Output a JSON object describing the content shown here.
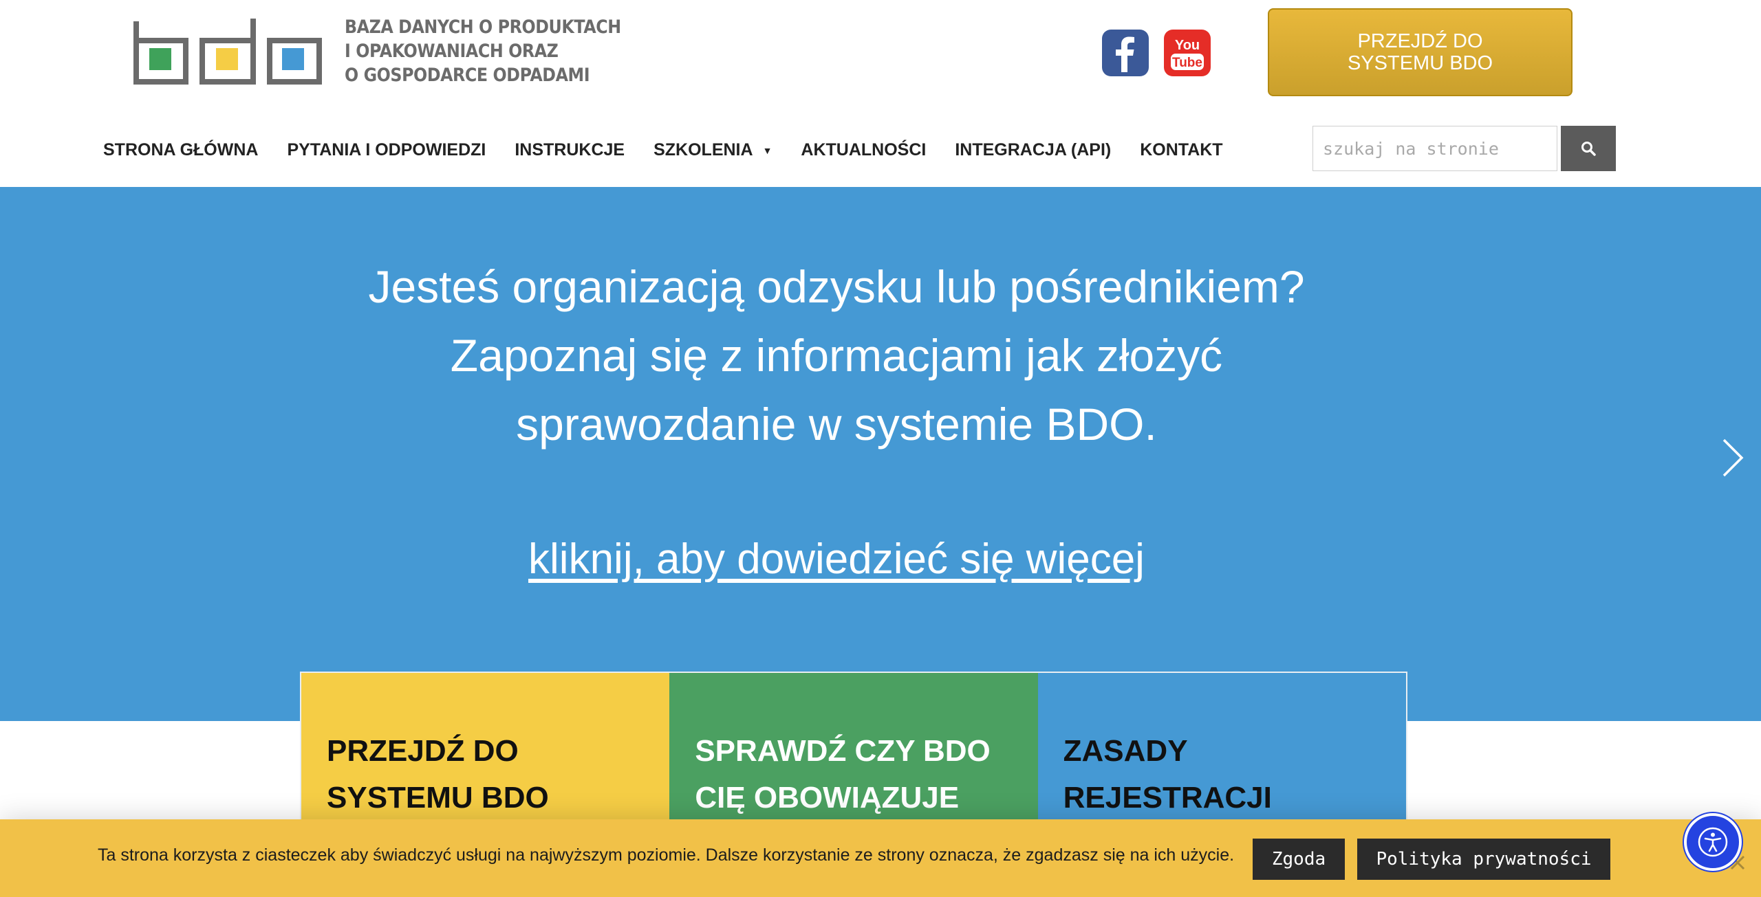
{
  "brand": {
    "logo_icon": "bdo-logo-icon",
    "logo_colors": {
      "green": "#3fa25a",
      "yellow": "#f5cd45",
      "blue": "#4599d4",
      "frame": "#6b6b6b"
    },
    "logo_lines": [
      "BAZA DANYCH O PRODUKTACH",
      "I OPAKOWANIACH ORAZ",
      "O GOSPODARCE ODPADAMI"
    ]
  },
  "social": {
    "facebook": {
      "icon": "facebook-icon",
      "glyph": "f",
      "color": "#3b5998"
    },
    "youtube": {
      "icon": "youtube-icon",
      "line1": "You",
      "line2": "Tube",
      "color": "#e52d27"
    }
  },
  "header_cta": {
    "line1": "PRZEJDŹ DO",
    "line2": "SYSTEMU BDO"
  },
  "nav": {
    "items": [
      {
        "label": "STRONA GŁÓWNA"
      },
      {
        "label": "PYTANIA I ODPOWIEDZI"
      },
      {
        "label": "INSTRUKCJE"
      },
      {
        "label": "SZKOLENIA",
        "caret": "▼"
      },
      {
        "label": "AKTUALNOŚCI"
      },
      {
        "label": "INTEGRACJA (API)"
      },
      {
        "label": "KONTAKT"
      }
    ]
  },
  "search": {
    "placeholder": "szukaj na stronie",
    "value": "",
    "button_icon": "search-icon"
  },
  "hero": {
    "lines": [
      "Jesteś organizacją odzysku lub pośrednikiem?",
      "Zapoznaj się z informacjami jak złożyć",
      "sprawozdanie w systemie BDO."
    ],
    "link": "kliknij, aby dowiedzieć się więcej",
    "next_icon": "chevron-right-icon",
    "background": "#4599d4"
  },
  "tiles": [
    {
      "line1": "PRZEJDŹ DO",
      "line2": "SYSTEMU BDO",
      "color": "#f5cd45"
    },
    {
      "line1": "SPRAWDŹ CZY BDO",
      "line2": "CIĘ OBOWIĄZUJE",
      "color": "#4ba061"
    },
    {
      "line1": "ZASADY",
      "line2": "REJESTRACJI",
      "color": "#4599d4"
    }
  ],
  "cookie": {
    "text": "Ta strona korzysta z ciasteczek aby świadczyć usługi na najwyższym poziomie. Dalsze korzystanie ze strony oznacza, że zgadzasz się na ich użycie.",
    "accept": "Zgoda",
    "policy": "Polityka prywatności",
    "close_icon": "close-icon",
    "background": "#f1c148"
  },
  "accessibility": {
    "icon": "accessibility-icon",
    "color": "#2443e0"
  }
}
